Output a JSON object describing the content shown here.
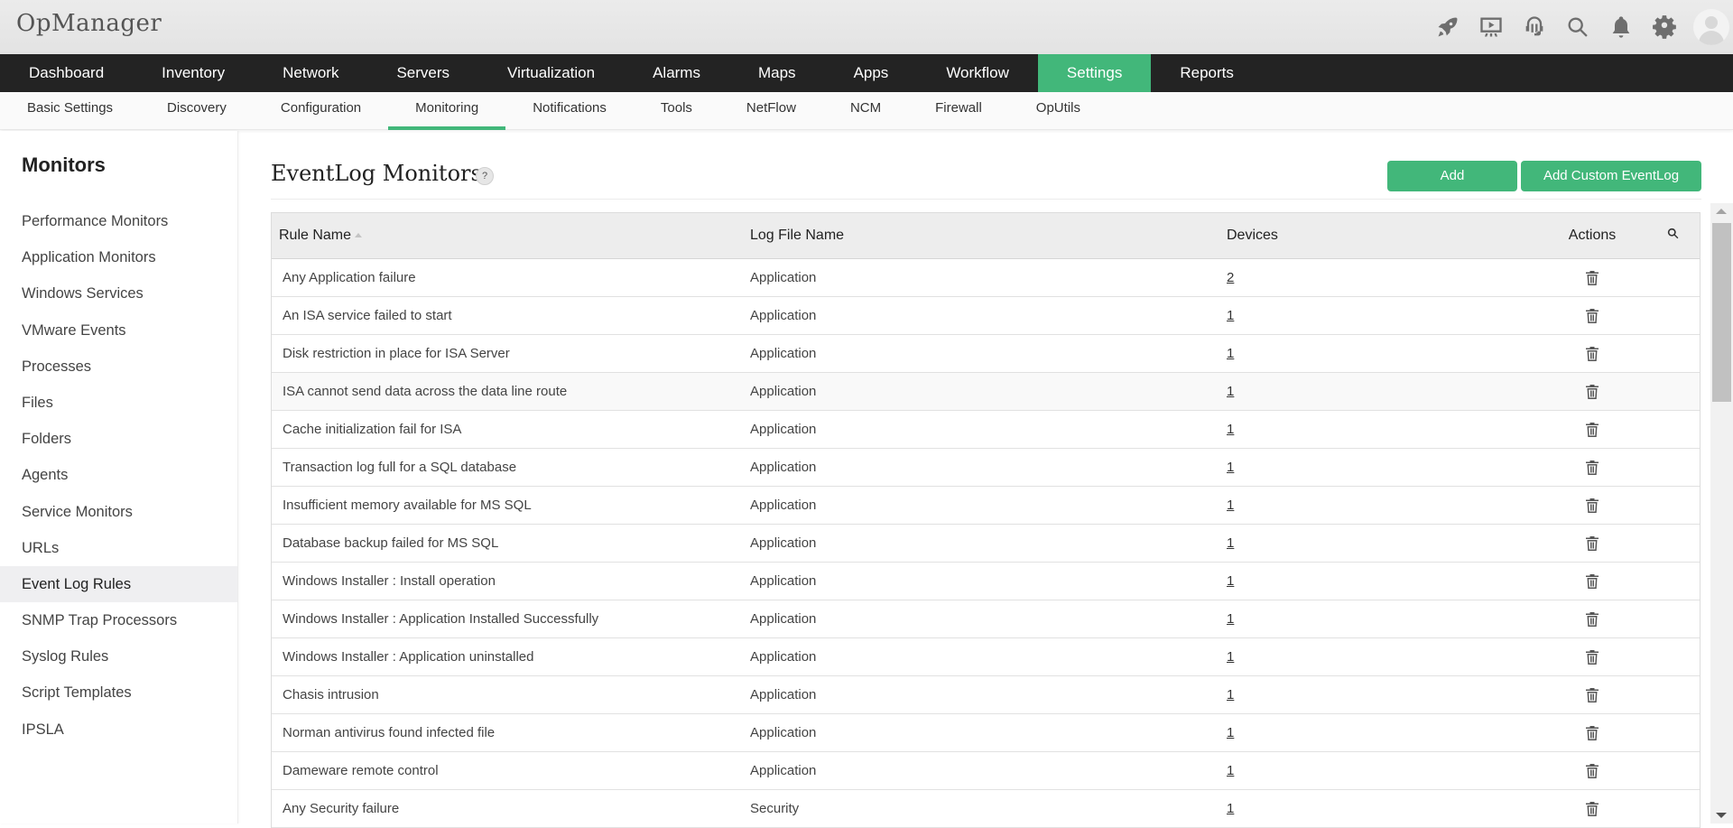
{
  "app": {
    "title": "OpManager"
  },
  "header_icons": [
    "rocket-icon",
    "presentation-icon",
    "headset-icon",
    "search-icon",
    "bell-icon",
    "gear-icon",
    "avatar"
  ],
  "main_nav": {
    "items": [
      {
        "label": "Dashboard",
        "active": false
      },
      {
        "label": "Inventory",
        "active": false
      },
      {
        "label": "Network",
        "active": false
      },
      {
        "label": "Servers",
        "active": false
      },
      {
        "label": "Virtualization",
        "active": false
      },
      {
        "label": "Alarms",
        "active": false
      },
      {
        "label": "Maps",
        "active": false
      },
      {
        "label": "Apps",
        "active": false
      },
      {
        "label": "Workflow",
        "active": false
      },
      {
        "label": "Settings",
        "active": true
      },
      {
        "label": "Reports",
        "active": false
      }
    ]
  },
  "sub_nav": {
    "items": [
      {
        "label": "Basic Settings",
        "active": false
      },
      {
        "label": "Discovery",
        "active": false
      },
      {
        "label": "Configuration",
        "active": false
      },
      {
        "label": "Monitoring",
        "active": true
      },
      {
        "label": "Notifications",
        "active": false
      },
      {
        "label": "Tools",
        "active": false
      },
      {
        "label": "NetFlow",
        "active": false
      },
      {
        "label": "NCM",
        "active": false
      },
      {
        "label": "Firewall",
        "active": false
      },
      {
        "label": "OpUtils",
        "active": false
      }
    ]
  },
  "sidebar": {
    "title": "Monitors",
    "items": [
      {
        "label": "Performance Monitors",
        "active": false
      },
      {
        "label": "Application Monitors",
        "active": false
      },
      {
        "label": "Windows Services",
        "active": false
      },
      {
        "label": "VMware Events",
        "active": false
      },
      {
        "label": "Processes",
        "active": false
      },
      {
        "label": "Files",
        "active": false
      },
      {
        "label": "Folders",
        "active": false
      },
      {
        "label": "Agents",
        "active": false
      },
      {
        "label": "Service Monitors",
        "active": false
      },
      {
        "label": "URLs",
        "active": false
      },
      {
        "label": "Event Log Rules",
        "active": true
      },
      {
        "label": "SNMP Trap Processors",
        "active": false
      },
      {
        "label": "Syslog Rules",
        "active": false
      },
      {
        "label": "Script Templates",
        "active": false
      },
      {
        "label": "IPSLA",
        "active": false
      }
    ]
  },
  "page": {
    "title": "EventLog Monitors",
    "help": "?",
    "add_label": "Add",
    "add_custom_label": "Add Custom EventLog"
  },
  "table": {
    "columns": {
      "rule_name": "Rule Name",
      "log_file": "Log File Name",
      "devices": "Devices",
      "actions": "Actions"
    },
    "sort": {
      "column": "Rule Name",
      "direction": "ascending"
    },
    "rows": [
      {
        "rule": "Any Application failure",
        "log": "Application",
        "devices": "2"
      },
      {
        "rule": "An ISA service failed to start",
        "log": "Application",
        "devices": "1"
      },
      {
        "rule": "Disk restriction in place for ISA Server",
        "log": "Application",
        "devices": "1"
      },
      {
        "rule": "ISA cannot send data across the data line route",
        "log": "Application",
        "devices": "1"
      },
      {
        "rule": "Cache initialization fail for ISA",
        "log": "Application",
        "devices": "1"
      },
      {
        "rule": "Transaction log full for a SQL database",
        "log": "Application",
        "devices": "1"
      },
      {
        "rule": "Insufficient memory available for MS SQL",
        "log": "Application",
        "devices": "1"
      },
      {
        "rule": "Database backup failed for MS SQL",
        "log": "Application",
        "devices": "1"
      },
      {
        "rule": "Windows Installer : Install operation",
        "log": "Application",
        "devices": "1"
      },
      {
        "rule": "Windows Installer : Application Installed Successfully",
        "log": "Application",
        "devices": "1"
      },
      {
        "rule": "Windows Installer : Application uninstalled",
        "log": "Application",
        "devices": "1"
      },
      {
        "rule": "Chasis intrusion",
        "log": "Application",
        "devices": "1"
      },
      {
        "rule": "Norman antivirus found infected file",
        "log": "Application",
        "devices": "1"
      },
      {
        "rule": "Dameware remote control",
        "log": "Application",
        "devices": "1"
      },
      {
        "rule": "Any Security failure",
        "log": "Security",
        "devices": "1"
      }
    ]
  },
  "colors": {
    "accent": "#42b77a",
    "nav_bg": "#232323",
    "header_bg": "#e6e6e6"
  }
}
